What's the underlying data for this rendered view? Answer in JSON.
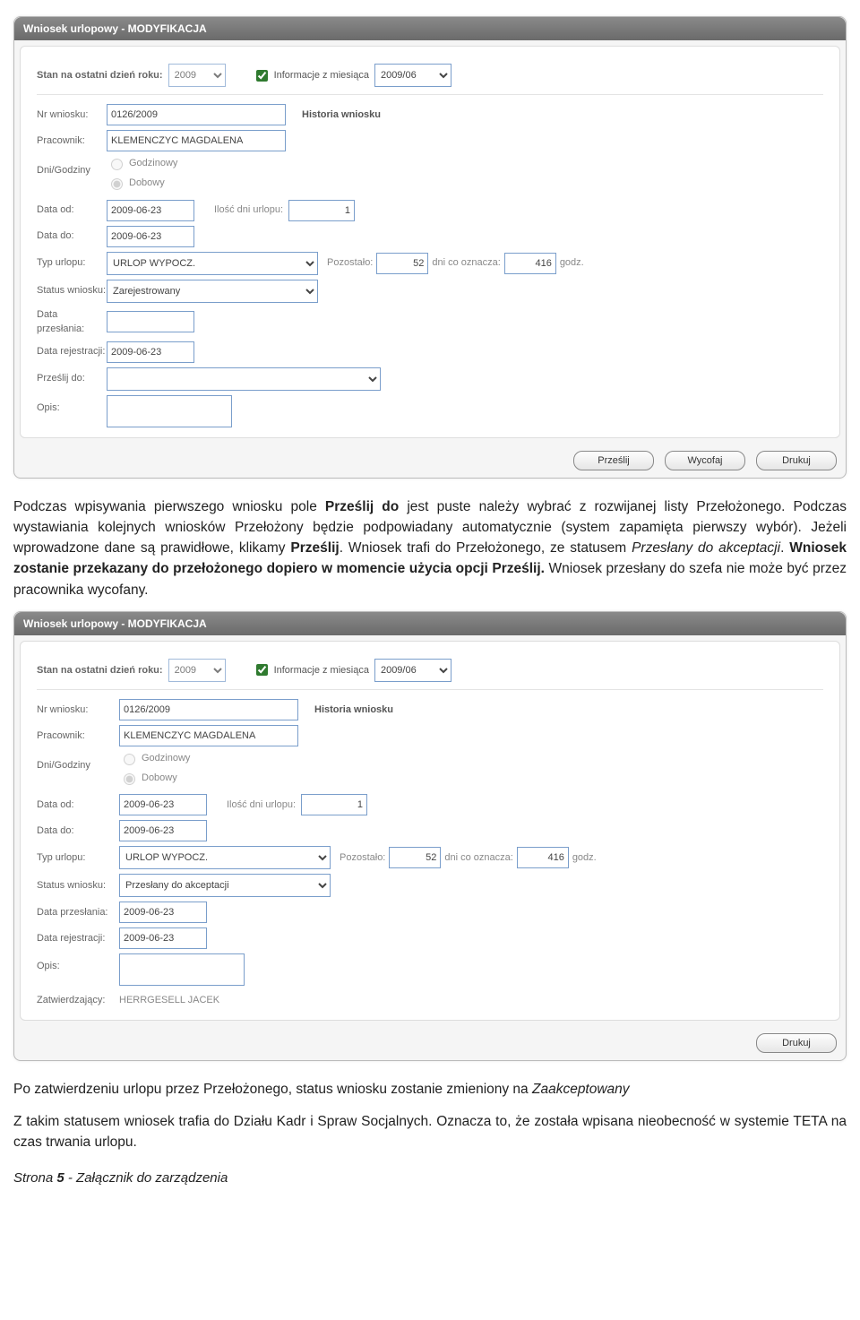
{
  "form1": {
    "title": "Wniosek urlopowy - MODYFIKACJA",
    "stan_label": "Stan na ostatni dzień roku:",
    "stan_year": "2009",
    "info_label": "Informacje z miesiąca",
    "info_month": "2009/06",
    "nr_label": "Nr wniosku:",
    "nr_value": "0126/2009",
    "historia": "Historia wniosku",
    "prac_label": "Pracownik:",
    "prac_value": "KLEMENCZYC MAGDALENA",
    "dg_label": "Dni/Godziny",
    "dg_opt1": "Godzinowy",
    "dg_opt2": "Dobowy",
    "data_od_label": "Data od:",
    "data_od_value": "2009-06-23",
    "ilosc_label": "Ilość dni urlopu:",
    "ilosc_value": "1",
    "data_do_label": "Data do:",
    "data_do_value": "2009-06-23",
    "typ_label": "Typ urlopu:",
    "typ_value": "URLOP WYPOCZ.",
    "pozost_label": "Pozostało:",
    "pozost_value": "52",
    "dni_co": "dni co oznacza:",
    "godz_value": "416",
    "godz_label": "godz.",
    "status_label": "Status wniosku:",
    "status_value": "Zarejestrowany",
    "data_przes_label": "Data przesłania:",
    "data_przes_value": "",
    "data_rej_label": "Data rejestracji:",
    "data_rej_value": "2009-06-23",
    "przeslij_do_label": "Prześlij do:",
    "przeslij_do_value": "",
    "opis_label": "Opis:",
    "opis_value": "",
    "btn_przeslij": "Prześlij",
    "btn_wycofaj": "Wycofaj",
    "btn_drukuj": "Drukuj"
  },
  "para1": {
    "t1": "Podczas wpisywania pierwszego wniosku pole ",
    "b1": "Prześlij do",
    "t2": " jest puste należy wybrać z rozwijanej listy Przełożonego. Podczas wystawiania kolejnych wniosków Przełożony będzie podpowiadany automatycznie (system zapamięta pierwszy wybór). Jeżeli wprowadzone dane są prawidłowe, klikamy ",
    "b2": "Prześlij",
    "t3": ". Wniosek trafi do Przełożonego, ze statusem ",
    "i1": "Przesłany do akceptacji",
    "t4": ". ",
    "b3": "Wniosek zostanie przekazany do przełożonego dopiero w momencie użycia opcji Prześlij.",
    "t5": " Wniosek przesłany do szefa nie może być przez pracownika wycofany."
  },
  "form2": {
    "title": "Wniosek urlopowy - MODYFIKACJA",
    "stan_label": "Stan na ostatni dzień roku:",
    "stan_year": "2009",
    "info_label": "Informacje z miesiąca",
    "info_month": "2009/06",
    "nr_label": "Nr wniosku:",
    "nr_value": "0126/2009",
    "historia": "Historia wniosku",
    "prac_label": "Pracownik:",
    "prac_value": "KLEMENCZYC MAGDALENA",
    "dg_label": "Dni/Godziny",
    "dg_opt1": "Godzinowy",
    "dg_opt2": "Dobowy",
    "data_od_label": "Data od:",
    "data_od_value": "2009-06-23",
    "ilosc_label": "Ilość dni urlopu:",
    "ilosc_value": "1",
    "data_do_label": "Data do:",
    "data_do_value": "2009-06-23",
    "typ_label": "Typ urlopu:",
    "typ_value": "URLOP WYPOCZ.",
    "pozost_label": "Pozostało:",
    "pozost_value": "52",
    "dni_co": "dni co oznacza:",
    "godz_value": "416",
    "godz_label": "godz.",
    "status_label": "Status wniosku:",
    "status_value": "Przesłany do akceptacji",
    "data_przes_label": "Data przesłania:",
    "data_przes_value": "2009-06-23",
    "data_rej_label": "Data rejestracji:",
    "data_rej_value": "2009-06-23",
    "opis_label": "Opis:",
    "opis_value": "",
    "zatw_label": "Zatwierdzający:",
    "zatw_value": "HERRGESELL JACEK",
    "btn_drukuj": "Drukuj"
  },
  "para2": {
    "t1": " Po zatwierdzeniu urlopu przez Przełożonego, status wniosku zostanie zmieniony na ",
    "i1": "Zaakceptowany"
  },
  "para3": "Z takim statusem wniosek trafia do Działu Kadr i Spraw Socjalnych. Oznacza to, że została wpisana nieobecność w systemie TETA na czas trwania urlopu.",
  "footer": {
    "a": "Strona ",
    "b": "5",
    "c": " - Załącznik do zarządzenia"
  }
}
